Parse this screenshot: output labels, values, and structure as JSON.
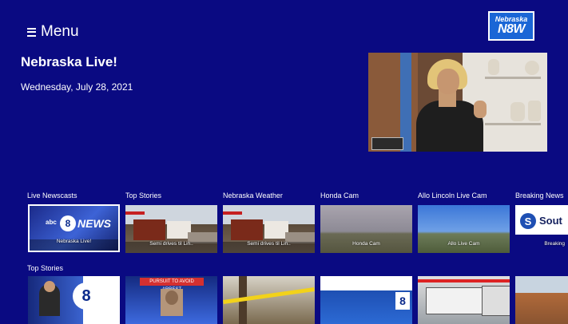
{
  "header": {
    "menu_label": "Menu",
    "logo": {
      "line1": "Nebraska",
      "line2": "N8W"
    }
  },
  "hero": {
    "title": "Nebraska Live!",
    "date": "Wednesday, July 28, 2021"
  },
  "rows": [
    {
      "label": "Live Newscasts",
      "cards": [
        {
          "caption": "Nebraska Live!",
          "brand": "abc",
          "news_text": "NEWS"
        }
      ]
    },
    {
      "label": "Top Stories",
      "cards": [
        {
          "caption": "Semi drives til Lin.."
        }
      ]
    },
    {
      "label": "Nebraska Weather",
      "cards": [
        {
          "caption": "Semi drives til Lin.."
        }
      ]
    },
    {
      "label": "Honda Cam",
      "cards": [
        {
          "caption": "Honda Cam"
        }
      ]
    },
    {
      "label": "Allo Lincoln Live Cam",
      "cards": [
        {
          "caption": "Allo Live Cam"
        }
      ]
    },
    {
      "label": "Breaking News",
      "cards": [
        {
          "caption": "Breaking",
          "brand": "Sout"
        }
      ]
    }
  ],
  "top_stories_row": {
    "label": "Top Stories",
    "banner_text": "PURSUIT TO AVOID ARREST"
  },
  "colors": {
    "background": "#0a0a82",
    "text": "#ffffff"
  }
}
